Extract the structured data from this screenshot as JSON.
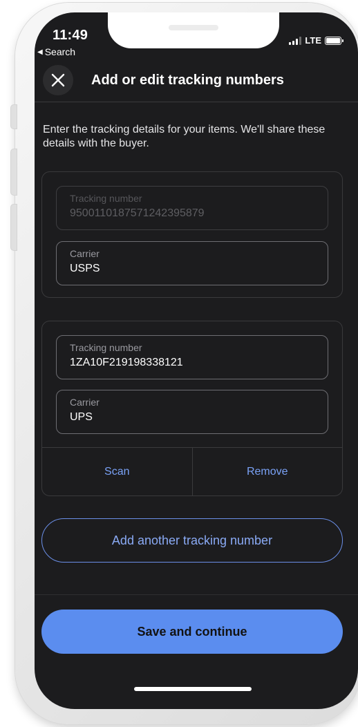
{
  "status_bar": {
    "time": "11:49",
    "back_label": "Search",
    "network": "LTE"
  },
  "header": {
    "title": "Add or edit tracking numbers",
    "close_icon": "close-icon"
  },
  "intro_text": "Enter the tracking details for your items. We'll share these details with the buyer.",
  "shipments": [
    {
      "tracking_label": "Tracking number",
      "tracking_value": "9500110187571242395879",
      "carrier_label": "Carrier",
      "carrier_value": "USPS",
      "editable": false
    },
    {
      "tracking_label": "Tracking number",
      "tracking_value": "1ZA10F219198338121",
      "carrier_label": "Carrier",
      "carrier_value": "UPS",
      "editable": true,
      "scan_label": "Scan",
      "remove_label": "Remove"
    }
  ],
  "add_button_label": "Add another tracking number",
  "save_button_label": "Save and continue",
  "colors": {
    "background": "#1c1c1e",
    "accent": "#5b8def",
    "link": "#7aa2f7"
  }
}
